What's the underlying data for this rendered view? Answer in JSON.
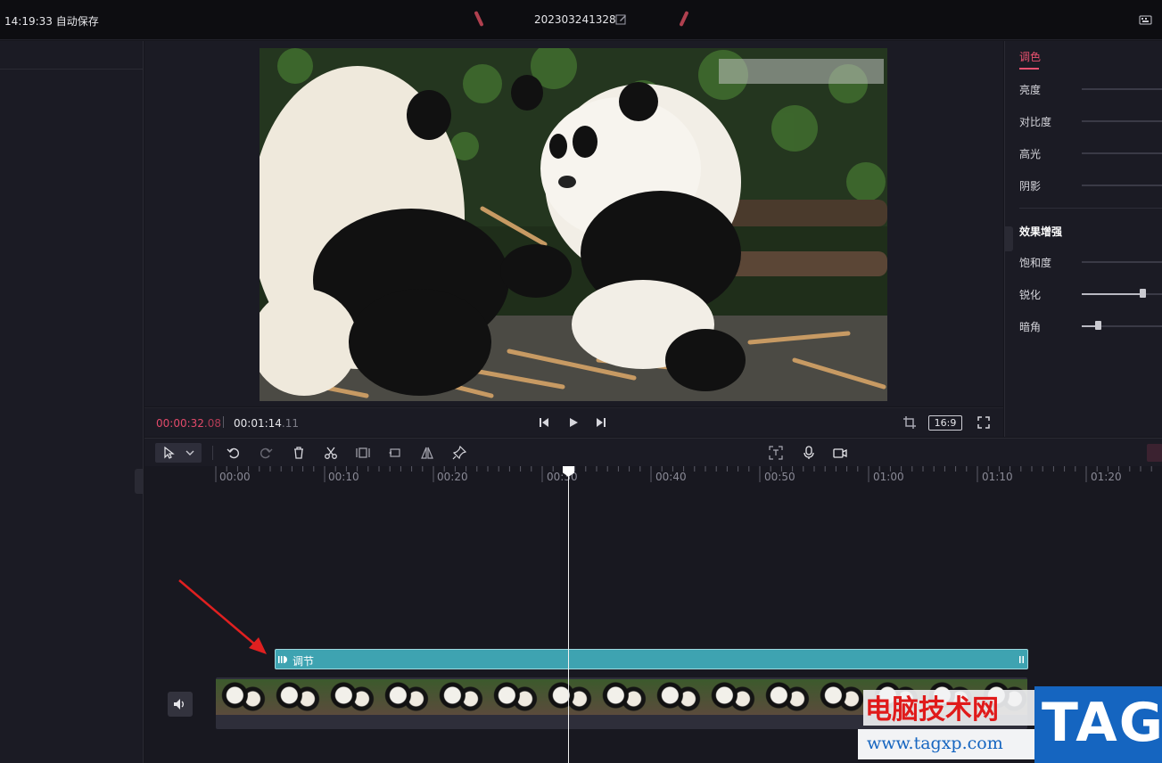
{
  "topbar": {
    "time": "14:19:33 自动保存",
    "project_name": "202303241328"
  },
  "preview": {
    "current_time": "00:00:32.08",
    "current_time_main": "00:00:32",
    "current_time_frac": ".08",
    "total_time_main": "00:01:14",
    "total_time_frac": ".11",
    "aspect_ratio": "16:9"
  },
  "right_panel": {
    "tab": "调色",
    "rows": [
      {
        "label": "亮度"
      },
      {
        "label": "对比度"
      },
      {
        "label": "高光"
      },
      {
        "label": "阴影"
      }
    ],
    "section_title": "效果增强",
    "rows2": [
      {
        "label": "饱和度"
      },
      {
        "label": "锐化",
        "value": 0.72
      },
      {
        "label": "暗角",
        "value": 0.19
      }
    ]
  },
  "timeline": {
    "ruler_labels": [
      "00:00",
      "00:10",
      "00:20",
      "00:30",
      "00:40",
      "00:50",
      "01:00",
      "01:10",
      "01:20"
    ],
    "adjust_clip_label": "调节"
  },
  "watermark": {
    "cn": "电脑技术网",
    "url": "www.tagxp.com",
    "tag": "TAG"
  },
  "colors": {
    "accent": "#e8516f",
    "clip": "#3ea3b1",
    "arrow": "#e02020"
  }
}
